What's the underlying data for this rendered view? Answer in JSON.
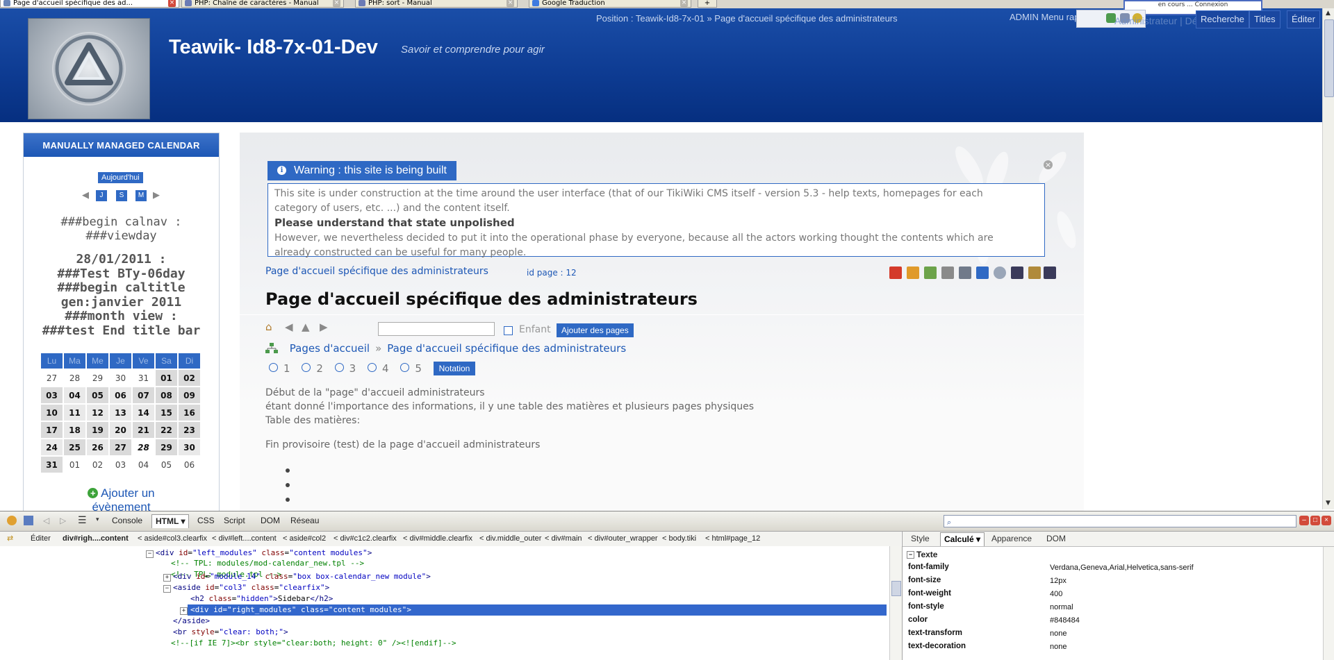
{
  "browser": {
    "tabs": [
      {
        "label": "Page d'accueil spécifique des ad...",
        "active": true
      },
      {
        "label": "PHP: Chaîne de caractères - Manual",
        "active": false
      },
      {
        "label": "PHP: sort - Manual",
        "active": false
      },
      {
        "label": "Google Traduction",
        "active": false
      }
    ],
    "new_tab_label": "+"
  },
  "header": {
    "site_title": "Teawik- Id8-7x-01-Dev",
    "slogan": "Savoir et comprendre pour agir",
    "position": "Position : Teawik-Id8-7x-01 » Page d'accueil spécifique des administrateurs",
    "admin_menu": "ADMIN Menu rapide :",
    "admin_ghost": "Administrateur | Déconnexion",
    "search_btn": "Recherche",
    "titles_btn": "Titles",
    "edit_btn": "Éditer",
    "login_strip": "en cours ... Connexion"
  },
  "calendar": {
    "title": "MANUALLY MANAGED CALENDAR",
    "today": "Aujourd'hui",
    "nav": [
      "J",
      "S",
      "M"
    ],
    "begin_calnav": "###begin calnav :",
    "viewday": "###viewday",
    "block_lines": [
      "28/01/2011 :",
      "###Test BTy-06day",
      "###begin caltitle",
      "gen:janvier 2011",
      "###month view :",
      "###test End title bar"
    ],
    "weekdays": [
      "Lu",
      "Ma",
      "Me",
      "Je",
      "Ve",
      "Sa",
      "Di"
    ],
    "weeks": [
      [
        "27",
        "28",
        "29",
        "30",
        "31",
        "01",
        "02"
      ],
      [
        "03",
        "04",
        "05",
        "06",
        "07",
        "08",
        "09"
      ],
      [
        "10",
        "11",
        "12",
        "13",
        "14",
        "15",
        "16"
      ],
      [
        "17",
        "18",
        "19",
        "20",
        "21",
        "22",
        "23"
      ],
      [
        "24",
        "25",
        "26",
        "27",
        "28",
        "29",
        "30"
      ],
      [
        "31",
        "01",
        "02",
        "03",
        "04",
        "05",
        "06"
      ]
    ],
    "add_event_line1": "Ajouter un",
    "add_event_line2": "évènement"
  },
  "warning": {
    "title": "Warning : this site is being built",
    "line1": "This site is under construction at the time around the user interface (that of our TikiWiki CMS itself - version 5.3 - help texts, homepages for each",
    "line2": "category of users, etc. ...) and the content itself.",
    "bold": "Please understand that state unpolished",
    "line3": "However, we nevertheless decided to put it into the operational phase by everyone, because all the actors working thought the contents which are",
    "line4": "already constructed can be useful for many people."
  },
  "page": {
    "breadcrumb": "Page d'accueil spécifique des administrateurs",
    "page_id": "id page : 12",
    "title": "Page d'accueil spécifique des administrateurs",
    "child_label": "Enfant",
    "add_pages": "Ajouter des pages",
    "struct_root": "Pages d'accueil",
    "struct_sep": "»",
    "struct_current": "Page d'accueil spécifique des administrateurs",
    "rating": [
      "1",
      "2",
      "3",
      "4",
      "5"
    ],
    "notation": "Notation",
    "body1": "Début de la \"page\" d'accueil administrateurs",
    "body2": "étant donné l'importance des informations, il y une table des matières et plusieurs pages physiques",
    "body3": "Table des matières:",
    "body4": "Fin provisoire (test) de la page d'accueil administrateurs"
  },
  "firebug": {
    "tabs": [
      "Console",
      "HTML",
      "CSS",
      "Script",
      "DOM",
      "Réseau"
    ],
    "edit": "Éditer",
    "path": [
      "div#righ....content",
      "aside#col3.clearfix",
      "div#left....content",
      "aside#col2",
      "div#c1c2.clearfix",
      "div#middle.clearfix",
      "div.middle_outer",
      "div#main",
      "div#outer_wrapper",
      "body.tiki",
      "html#page_12"
    ],
    "side_tabs": [
      "Style",
      "Calculé",
      "Apparence",
      "DOM"
    ],
    "group": "Texte",
    "props": [
      {
        "name": "font-family",
        "value": "Verdana,Geneva,Arial,Helvetica,sans-serif"
      },
      {
        "name": "font-size",
        "value": "12px"
      },
      {
        "name": "font-weight",
        "value": "400"
      },
      {
        "name": "font-style",
        "value": "normal"
      },
      {
        "name": "color",
        "value": "#848484"
      },
      {
        "name": "text-transform",
        "value": "none"
      },
      {
        "name": "text-decoration",
        "value": "none"
      }
    ]
  }
}
